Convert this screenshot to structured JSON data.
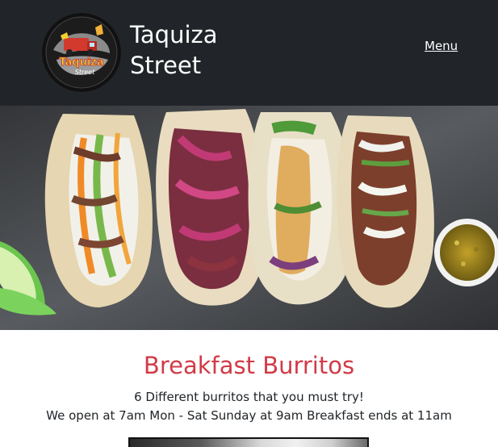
{
  "header": {
    "brand_line1": "Taquiza",
    "brand_line2": "Street",
    "menu_label": "Menu",
    "logo_text_1": "Taquiza",
    "logo_text_2": "Street"
  },
  "hero": {
    "image_name": "tacos-photo"
  },
  "main": {
    "title": "Breakfast Burritos",
    "subtitle": "6 Different burritos that you must try!",
    "hours": "We open at 7am Mon - Sat Sunday at 9am Breakfast ends at 11am"
  },
  "colors": {
    "header_bg": "#212529",
    "title": "#d13b47",
    "text": "#212529"
  }
}
